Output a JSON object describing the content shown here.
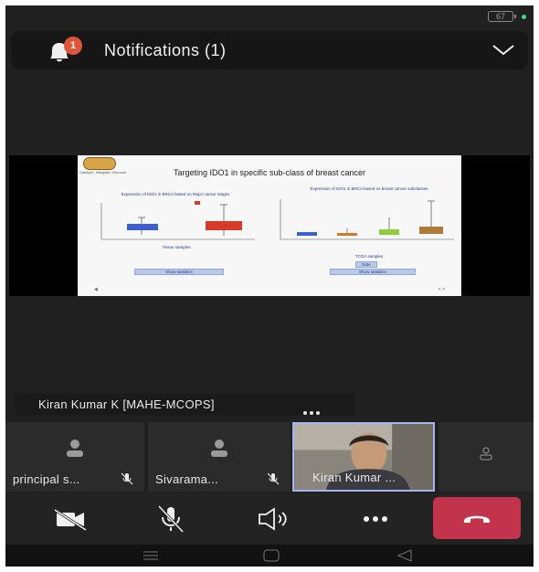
{
  "status_bar": {
    "battery": "67"
  },
  "notifications": {
    "title": "Notifications (1)",
    "badge_count": "1"
  },
  "shared_slide": {
    "logo_text": "CALCAN",
    "logo_subtitle": "Catalyze, Integrate, Discover",
    "title": "Targeting IDO1 in specific sub-class of breast cancer",
    "left_chart_caption": "Expression of IDO1 in BRCA based on Major cancer stages",
    "left_chart_xlabel": "Tissue samples",
    "left_stat_button": "Show statistics",
    "right_chart_caption": "Expression of IDO1 in BRCA based on breast cancer subclasses",
    "right_chart_xlabel": "TCGA samples",
    "right_note_button": "Note",
    "right_stat_button": "Show statistics",
    "page_indicator": "< >"
  },
  "presenter_strip": {
    "name": "Kiran Kumar K [MAHE-MCOPS]"
  },
  "participants": [
    {
      "name": "principal s...",
      "muted": true
    },
    {
      "name": "Sivarama...",
      "muted": true
    },
    {
      "name": "Kiran Kumar ...",
      "muted": false,
      "video": true
    }
  ],
  "controls": {
    "camera": "video-off-icon",
    "mic": "mic-off-icon",
    "speaker": "speaker-icon",
    "more": "more-icon",
    "end_call": "end-call-icon"
  },
  "colors": {
    "end_call": "#c2344c",
    "badge": "#e0563b",
    "active_border": "#a8b4f0"
  }
}
